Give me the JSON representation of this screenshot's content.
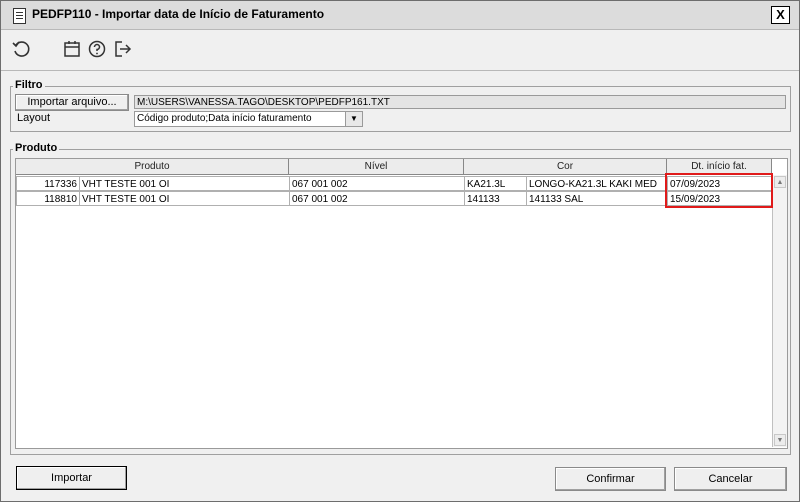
{
  "window": {
    "title": "PEDFP110 - Importar data de Início de Faturamento",
    "close_label": "X"
  },
  "toolbar": {
    "icons": [
      "refresh-icon",
      "calendar-icon",
      "help-icon",
      "exit-icon"
    ]
  },
  "filtro": {
    "label": "Filtro",
    "import_button": "Importar arquivo...",
    "file_path": "M:\\USERS\\VANESSA.TAGO\\DESKTOP\\PEDFP161.TXT",
    "layout_label": "Layout",
    "layout_value": "Código produto;Data início faturamento"
  },
  "produto": {
    "label": "Produto",
    "columns": [
      "Produto",
      "Nível",
      "Cor",
      "Dt. início fat."
    ],
    "rows": [
      {
        "code": "117336",
        "name": "VHT TESTE 001 OI",
        "nivel": "067 001 002",
        "cor_code": "KA21.3L",
        "cor_desc": "LONGO-KA21.3L KAKI MED",
        "date": "07/09/2023"
      },
      {
        "code": "118810",
        "name": "VHT TESTE 001 OI",
        "nivel": "067 001 002",
        "cor_code": "141133",
        "cor_desc": "141133 SAL",
        "date": "15/09/2023"
      }
    ]
  },
  "footer": {
    "import": "Importar",
    "confirm": "Confirmar",
    "cancel": "Cancelar"
  },
  "colors": {
    "highlight": "#e01a1a"
  }
}
